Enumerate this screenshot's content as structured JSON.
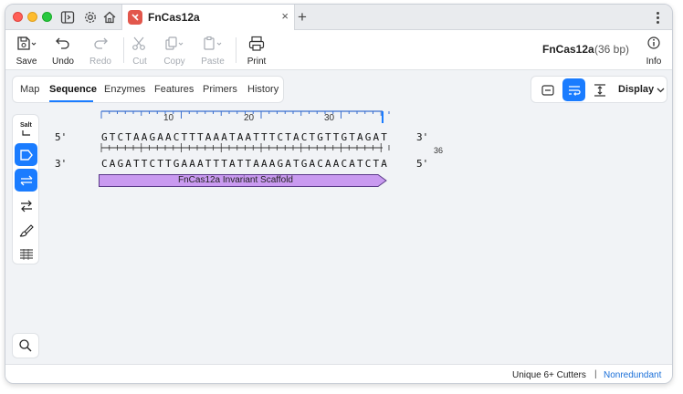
{
  "tab": {
    "title": "FnCas12a",
    "close": "×",
    "new": "+"
  },
  "toolbar": {
    "save": "Save",
    "undo": "Undo",
    "redo": "Redo",
    "cut": "Cut",
    "copy": "Copy",
    "paste": "Paste",
    "print": "Print",
    "info": "Info"
  },
  "sequence_info": {
    "name": "FnCas12a",
    "length": "(36 bp)"
  },
  "view_tabs": [
    "Map",
    "Sequence",
    "Enzymes",
    "Features",
    "Primers",
    "History"
  ],
  "active_view_tab": "Sequence",
  "display_menu": {
    "label": "Display"
  },
  "side_tools": {
    "salt_label": "Salt"
  },
  "ruler": {
    "ticks": [
      "10",
      "20",
      "30"
    ]
  },
  "sequence": {
    "top_5": "5'",
    "top_3": "3'",
    "bottom_3": "3'",
    "bottom_5": "5'",
    "top_strand": "GTCTAAGAACTTTAAATAATTTCTACTGTTGTAGAT",
    "bottom_strand": "CAGATTCTTGAAATTTATTAAAGATGACAACATCTA",
    "end_position": "36"
  },
  "feature": {
    "label": "FnCas12a Invariant Scaffold",
    "color": "#c99af0"
  },
  "status": {
    "cutters": "Unique 6+ Cutters",
    "separator": "|",
    "nonredundant": "Nonredundant"
  },
  "colors": {
    "accent": "#1a7cff"
  }
}
